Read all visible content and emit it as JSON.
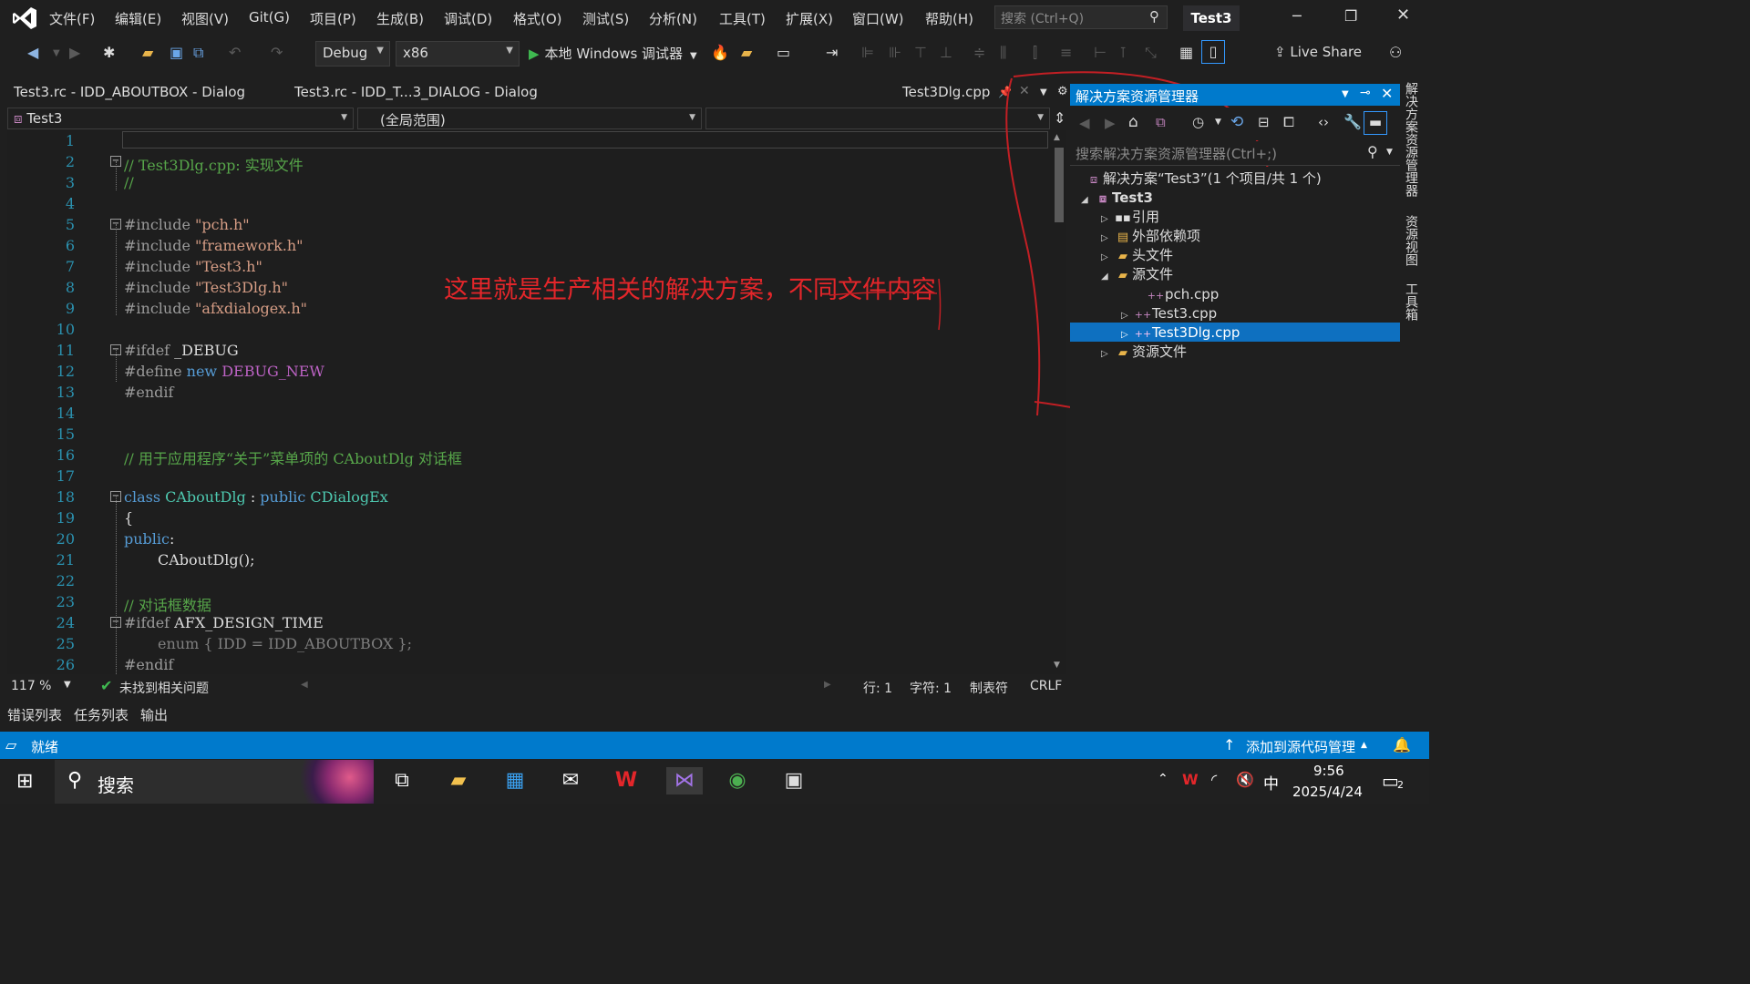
{
  "menu": {
    "items": [
      "文件(F)",
      "编辑(E)",
      "视图(V)",
      "Git(G)",
      "项目(P)",
      "生成(B)",
      "调试(D)",
      "格式(O)",
      "测试(S)",
      "分析(N)",
      "工具(T)",
      "扩展(X)",
      "窗口(W)",
      "帮助(H)"
    ],
    "search_placeholder": "搜索 (Ctrl+Q)",
    "solution_name": "Test3"
  },
  "toolbar": {
    "config": "Debug",
    "platform": "x86",
    "run_label": "本地 Windows 调试器",
    "live_share": "Live Share"
  },
  "tabs": {
    "tab1": "Test3.rc - IDD_ABOUTBOX - Dialog",
    "tab2": "Test3.rc - IDD_T...3_DIALOG - Dialog",
    "tab3": "Test3Dlg.cpp"
  },
  "navbar": {
    "project": "Test3",
    "scope": "(全局范围)",
    "member": ""
  },
  "editor": {
    "line_numbers": [
      "1",
      "2",
      "3",
      "4",
      "5",
      "6",
      "7",
      "8",
      "9",
      "10",
      "11",
      "12",
      "13",
      "14",
      "15",
      "16",
      "17",
      "18",
      "19",
      "20",
      "21",
      "22",
      "23",
      "24",
      "25",
      "26"
    ],
    "lines": {
      "l2": "// Test3Dlg.cpp: 实现文件",
      "l3": "//",
      "l5_pp": "#include",
      "l5_str": " \"pch.h\"",
      "l6_pp": "#include",
      "l6_str": " \"framework.h\"",
      "l7_pp": "#include",
      "l7_str": " \"Test3.h\"",
      "l8_pp": "#include",
      "l8_str": " \"Test3Dlg.h\"",
      "l9_pp": "#include",
      "l9_str": " \"afxdialogex.h\"",
      "l11_pp": "#ifdef",
      "l11_id": " _DEBUG",
      "l12_pp": "#define",
      "l12_kw": " new",
      "l12_mac": " DEBUG_NEW",
      "l13_pp": "#endif",
      "l16": "// 用于应用程序“关于”菜单项的 CAboutDlg 对话框",
      "l18_kw": "class",
      "l18_ty": " CAboutDlg",
      "l18_op": " :",
      "l18_kw2": " public",
      "l18_ty2": " CDialogEx",
      "l19": "{",
      "l20_kw": "public",
      "l20_op": ":",
      "l21": "CAboutDlg();",
      "l23": "// 对话框数据",
      "l24_pp": "#ifdef",
      "l24_id": " AFX_DESIGN_TIME",
      "l25": "enum { IDD = IDD_ABOUTBOX };",
      "l26_pp": "#endif"
    }
  },
  "editor_status": {
    "zoom": "117 %",
    "issues": "未找到相关问题",
    "line": "行: 1",
    "char": "字符: 1",
    "tabs": "制表符",
    "eol": "CRLF"
  },
  "annotation": "这里就是生产相关的解决方案，不同文件内容",
  "solution_explorer": {
    "title": "解决方案资源管理器",
    "search_placeholder": "搜索解决方案资源管理器(Ctrl+;)",
    "solution_node": "解决方案“Test3”(1 个项目/共 1 个)",
    "project_node": "Test3",
    "references": "引用",
    "external_deps": "外部依赖项",
    "headers": "头文件",
    "sources": "源文件",
    "file1": "pch.cpp",
    "file2": "Test3.cpp",
    "file3": "Test3Dlg.cpp",
    "resources": "资源文件"
  },
  "side_tabs": {
    "t1": "解决方案资源管理器",
    "t2": "资源视图",
    "t3": "工具箱"
  },
  "bottom_tabs": [
    "错误列表",
    "任务列表",
    "输出"
  ],
  "statusbar": {
    "ready": "就绪",
    "source_control": "添加到源代码管理"
  },
  "taskbar": {
    "search": "搜索",
    "time": "9:56",
    "date": "2025/4/24",
    "ime": "中",
    "notifications": "2"
  },
  "colors": {
    "accent": "#007acc",
    "annotation": "#e3262a",
    "selection": "#0e70c0"
  }
}
